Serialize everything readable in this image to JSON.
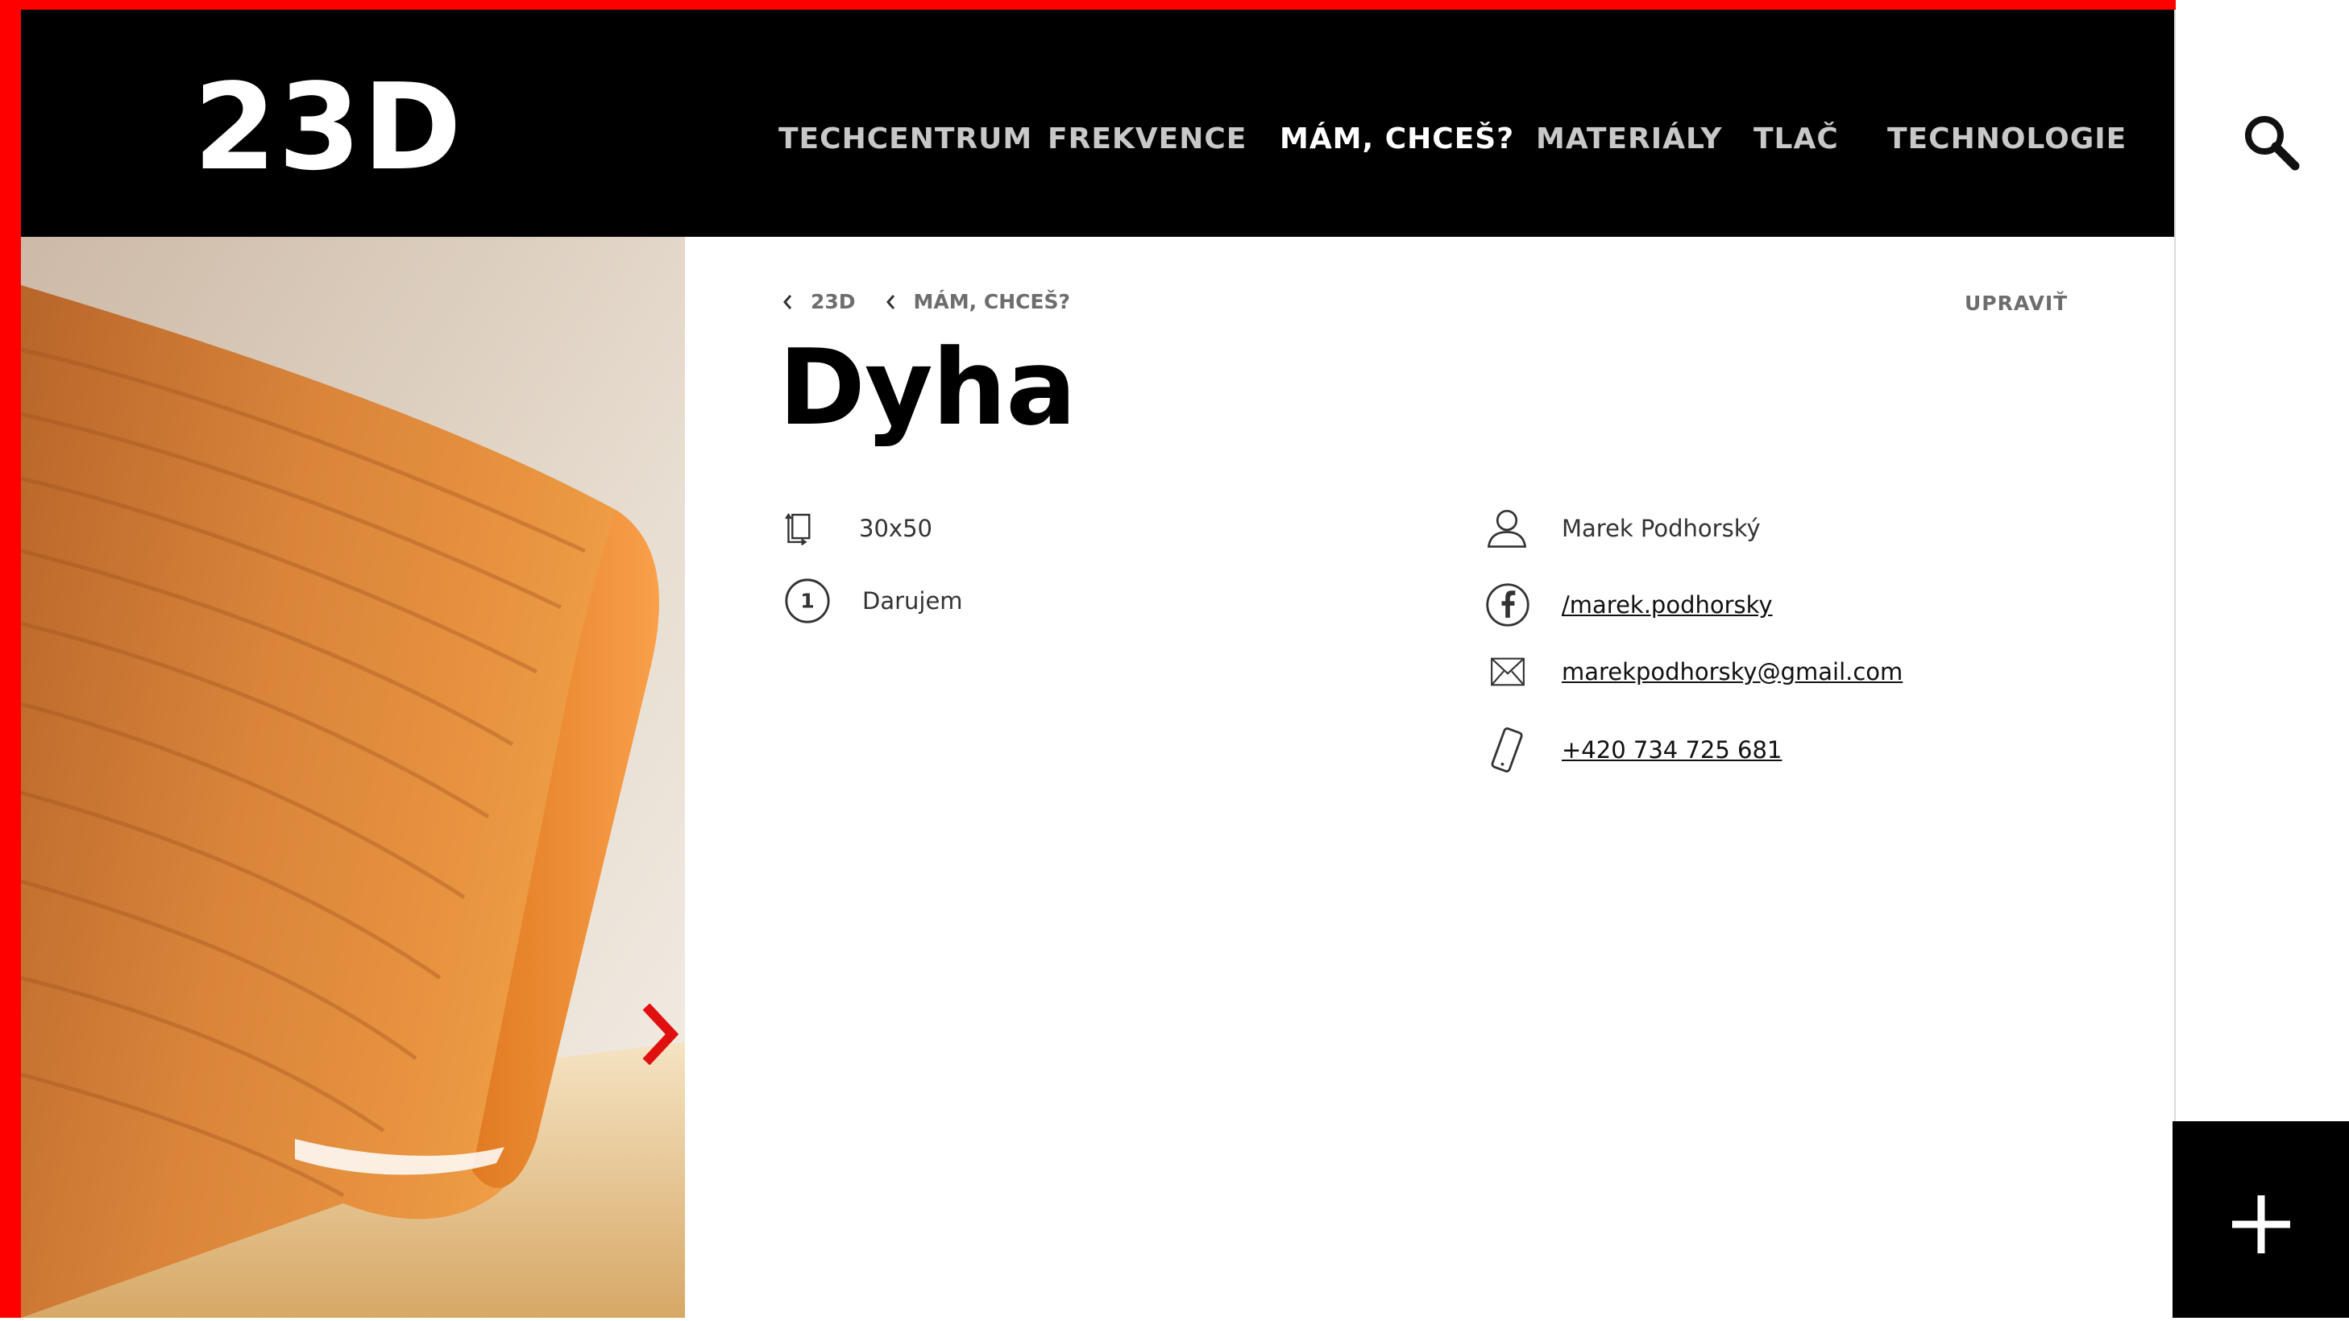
{
  "header": {
    "logo": "23D",
    "nav": [
      {
        "label": "TECHCENTRUM",
        "active": false
      },
      {
        "label": "FREKVENCE",
        "active": false
      },
      {
        "label": "MÁM, CHCEŠ?",
        "active": true
      },
      {
        "label": "MATERIÁLY",
        "active": false
      },
      {
        "label": "TLAČ",
        "active": false
      },
      {
        "label": "TECHNOLOGIE",
        "active": false
      }
    ],
    "search_icon": "search-icon"
  },
  "breadcrumb": [
    {
      "label": "23D"
    },
    {
      "label": "MÁM, CHCEŠ?"
    }
  ],
  "edit_label": "UPRAVIŤ",
  "title": "Dyha",
  "details": {
    "size": "30x50",
    "type": "Darujem"
  },
  "contact": {
    "name": "Marek Podhorský",
    "facebook": "/marek.podhorsky",
    "email": "marekpodhorsky@gmail.com",
    "phone": "+420 734 725 681"
  },
  "colors": {
    "accent": "#ff0000",
    "header_bg": "#000000",
    "nav_active": "#ffffff",
    "nav_inactive": "#c8c8c8"
  }
}
